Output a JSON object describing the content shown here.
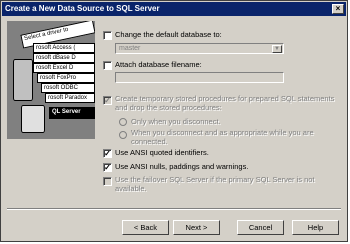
{
  "window": {
    "title": "Create a New Data Source to SQL Server",
    "close_glyph": "×"
  },
  "art": {
    "cards": [
      "Select a driver to",
      "rosoft Access (",
      "rosoft dBase D",
      "rosoft Excel D",
      "rosoft FoxPro",
      "rosoft ODBC",
      "rosoft Paradox",
      "QL Server"
    ]
  },
  "options": {
    "change_default_db": {
      "label": "Change the default database to:",
      "checked": false,
      "value": "master"
    },
    "attach_filename": {
      "label": "Attach database filename:",
      "checked": false,
      "value": ""
    },
    "temp_procs": {
      "label_line1": "Create temporary stored procedures for prepared SQL statements",
      "label_line2": "and drop the stored procedures:",
      "checked": true,
      "disabled": true
    },
    "radio_disconnect": {
      "label": "Only when you disconnect."
    },
    "radio_appropriate": {
      "label_line1": "When you disconnect and as appropriate while you are",
      "label_line2": "connected."
    },
    "ansi_quoted": {
      "label": "Use ANSI quoted identifiers.",
      "checked": true
    },
    "ansi_nulls": {
      "label": "Use ANSI nulls, paddings and warnings.",
      "checked": true
    },
    "failover": {
      "label_line1": "Use the failover SQL Server if the primary SQL Server is not",
      "label_line2": "available.",
      "checked": false,
      "disabled": true
    }
  },
  "buttons": {
    "back": "< Back",
    "next": "Next >",
    "cancel": "Cancel",
    "help": "Help"
  },
  "check_glyph": "✓",
  "dropdown_glyph": "▼"
}
